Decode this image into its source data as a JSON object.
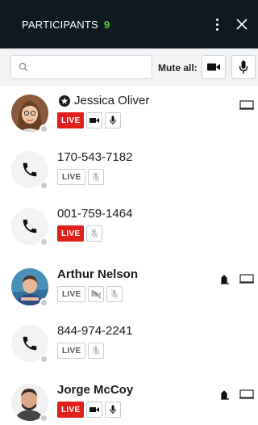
{
  "header": {
    "title": "PARTICIPANTS",
    "count": "9"
  },
  "toolbar": {
    "search_placeholder": "",
    "mute_all_label": "Mute all:"
  },
  "participants": [
    {
      "name": "Jessica Oliver",
      "avatar": "photo-woman",
      "moderator": true,
      "live": true,
      "video": "on",
      "audio": "on",
      "hand": false,
      "screen": true
    },
    {
      "name": "170-543-7182",
      "avatar": "phone-icon",
      "moderator": false,
      "live": false,
      "video": "none",
      "audio": "muted",
      "hand": false,
      "screen": false
    },
    {
      "name": "001-759-1464",
      "avatar": "phone-icon",
      "moderator": false,
      "live": true,
      "video": "none",
      "audio": "muted",
      "hand": false,
      "screen": false
    },
    {
      "name": "Arthur Nelson",
      "avatar": "photo-man-blue",
      "moderator": false,
      "live": false,
      "video": "muted",
      "audio": "muted",
      "hand": true,
      "screen": true
    },
    {
      "name": "844-974-2241",
      "avatar": "phone-icon",
      "moderator": false,
      "live": false,
      "video": "none",
      "audio": "muted",
      "hand": false,
      "screen": false
    },
    {
      "name": "Jorge McCoy",
      "avatar": "photo-man-beard",
      "moderator": false,
      "live": true,
      "video": "on",
      "audio": "on",
      "hand": true,
      "screen": true
    }
  ],
  "colors": {
    "header_bg": "#0f1a20",
    "count": "#4cd432",
    "live": "#e0201c"
  }
}
